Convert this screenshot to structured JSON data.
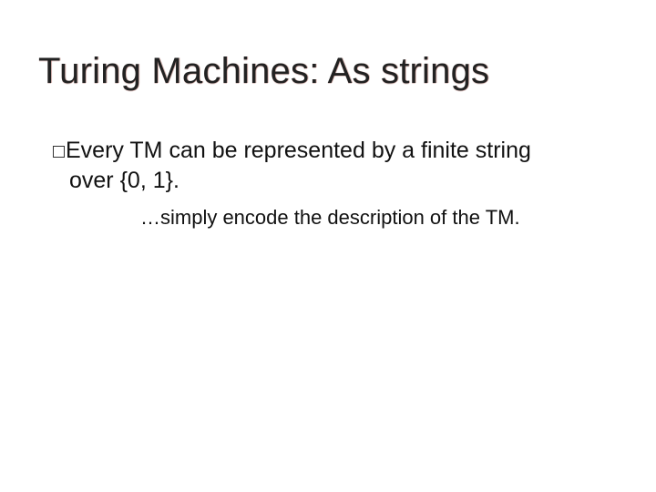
{
  "title": "Turing Machines:  As strings",
  "bullet": {
    "line1": "Every TM can be represented by a finite string",
    "line2": "over {0, 1}."
  },
  "subnote": "…simply encode the description of the TM."
}
